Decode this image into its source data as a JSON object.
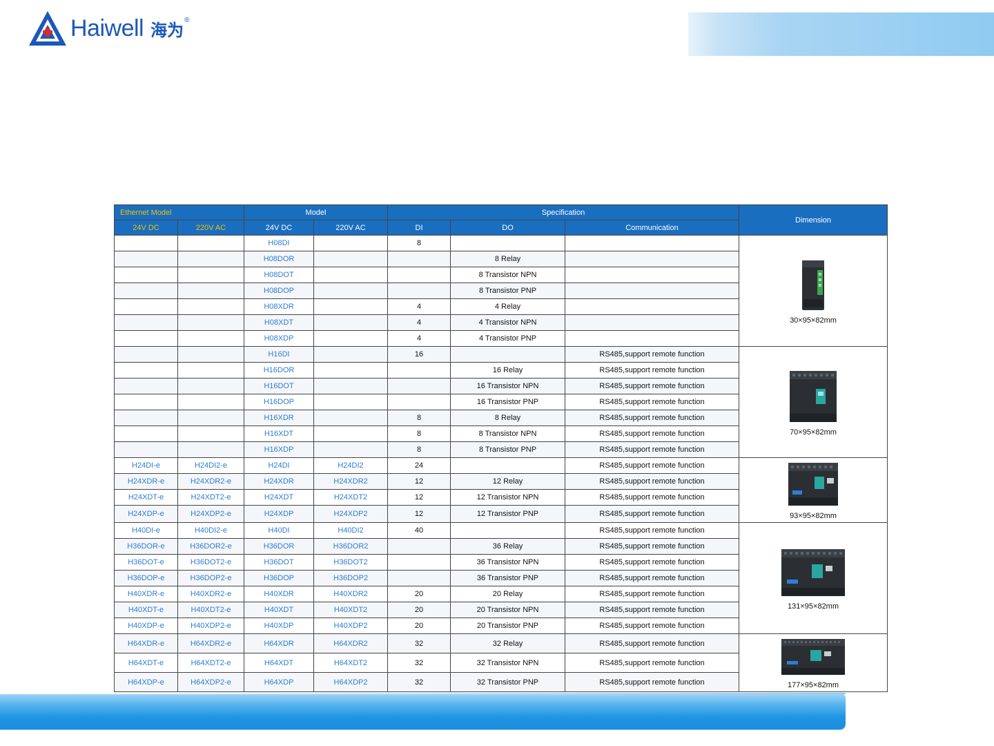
{
  "brand": {
    "name_en": "Haiwell",
    "name_cn": "海为",
    "registered": "®"
  },
  "colors": {
    "header": "#1a6ec0",
    "header_accent": "#f0c000",
    "model_text": "#2d7dd2",
    "brand": "#1b58b8"
  },
  "table": {
    "group_headers": {
      "ethernet": "Ethernet Model",
      "model": "Model",
      "specification": "Specification",
      "dimension": "Dimension"
    },
    "sub_headers": {
      "eth_24vdc": "24V DC",
      "eth_220vac": "220V AC",
      "model_24vdc": "24V DC",
      "model_220vac": "220V AC",
      "di": "DI",
      "do": "DO",
      "communication": "Communication"
    },
    "rows": [
      {
        "eth_dc": "",
        "eth_ac": "",
        "dc": "H08DI",
        "ac": "",
        "di": "8",
        "do": "",
        "comm": ""
      },
      {
        "eth_dc": "",
        "eth_ac": "",
        "dc": "H08DOR",
        "ac": "",
        "di": "",
        "do": "8 Relay",
        "comm": ""
      },
      {
        "eth_dc": "",
        "eth_ac": "",
        "dc": "H08DOT",
        "ac": "",
        "di": "",
        "do": "8 Transistor NPN",
        "comm": ""
      },
      {
        "eth_dc": "",
        "eth_ac": "",
        "dc": "H08DOP",
        "ac": "",
        "di": "",
        "do": "8 Transistor PNP",
        "comm": ""
      },
      {
        "eth_dc": "",
        "eth_ac": "",
        "dc": "H08XDR",
        "ac": "",
        "di": "4",
        "do": "4 Relay",
        "comm": ""
      },
      {
        "eth_dc": "",
        "eth_ac": "",
        "dc": "H08XDT",
        "ac": "",
        "di": "4",
        "do": "4 Transistor NPN",
        "comm": ""
      },
      {
        "eth_dc": "",
        "eth_ac": "",
        "dc": "H08XDP",
        "ac": "",
        "di": "4",
        "do": "4 Transistor PNP",
        "comm": ""
      },
      {
        "eth_dc": "",
        "eth_ac": "",
        "dc": "H16DI",
        "ac": "",
        "di": "16",
        "do": "",
        "comm": "RS485,support remote function"
      },
      {
        "eth_dc": "",
        "eth_ac": "",
        "dc": "H16DOR",
        "ac": "",
        "di": "",
        "do": "16 Relay",
        "comm": "RS485,support remote function"
      },
      {
        "eth_dc": "",
        "eth_ac": "",
        "dc": "H16DOT",
        "ac": "",
        "di": "",
        "do": "16 Transistor NPN",
        "comm": "RS485,support remote function"
      },
      {
        "eth_dc": "",
        "eth_ac": "",
        "dc": "H16DOP",
        "ac": "",
        "di": "",
        "do": "16 Transistor PNP",
        "comm": "RS485,support remote function"
      },
      {
        "eth_dc": "",
        "eth_ac": "",
        "dc": "H16XDR",
        "ac": "",
        "di": "8",
        "do": "8 Relay",
        "comm": "RS485,support remote function"
      },
      {
        "eth_dc": "",
        "eth_ac": "",
        "dc": "H16XDT",
        "ac": "",
        "di": "8",
        "do": "8 Transistor NPN",
        "comm": "RS485,support remote function"
      },
      {
        "eth_dc": "",
        "eth_ac": "",
        "dc": "H16XDP",
        "ac": "",
        "di": "8",
        "do": "8 Transistor PNP",
        "comm": "RS485,support remote function"
      },
      {
        "eth_dc": "H24DI-e",
        "eth_ac": "H24DI2-e",
        "dc": "H24DI",
        "ac": "H24DI2",
        "di": "24",
        "do": "",
        "comm": "RS485,support remote function"
      },
      {
        "eth_dc": "H24XDR-e",
        "eth_ac": "H24XDR2-e",
        "dc": "H24XDR",
        "ac": "H24XDR2",
        "di": "12",
        "do": "12 Relay",
        "comm": "RS485,support remote function"
      },
      {
        "eth_dc": "H24XDT-e",
        "eth_ac": "H24XDT2-e",
        "dc": "H24XDT",
        "ac": "H24XDT2",
        "di": "12",
        "do": "12 Transistor NPN",
        "comm": "RS485,support remote function"
      },
      {
        "eth_dc": "H24XDP-e",
        "eth_ac": "H24XDP2-e",
        "dc": "H24XDP",
        "ac": "H24XDP2",
        "di": "12",
        "do": "12 Transistor PNP",
        "comm": "RS485,support remote function"
      },
      {
        "eth_dc": "H40DI-e",
        "eth_ac": "H40DI2-e",
        "dc": "H40DI",
        "ac": "H40DI2",
        "di": "40",
        "do": "",
        "comm": "RS485,support remote function"
      },
      {
        "eth_dc": "H36DOR-e",
        "eth_ac": "H36DOR2-e",
        "dc": "H36DOR",
        "ac": "H36DOR2",
        "di": "",
        "do": "36 Relay",
        "comm": "RS485,support remote function"
      },
      {
        "eth_dc": "H36DOT-e",
        "eth_ac": "H36DOT2-e",
        "dc": "H36DOT",
        "ac": "H36DOT2",
        "di": "",
        "do": "36 Transistor NPN",
        "comm": "RS485,support remote function"
      },
      {
        "eth_dc": "H36DOP-e",
        "eth_ac": "H36DOP2-e",
        "dc": "H36DOP",
        "ac": "H36DOP2",
        "di": "",
        "do": "36 Transistor PNP",
        "comm": "RS485,support remote function"
      },
      {
        "eth_dc": "H40XDR-e",
        "eth_ac": "H40XDR2-e",
        "dc": "H40XDR",
        "ac": "H40XDR2",
        "di": "20",
        "do": "20 Relay",
        "comm": "RS485,support remote function"
      },
      {
        "eth_dc": "H40XDT-e",
        "eth_ac": "H40XDT2-e",
        "dc": "H40XDT",
        "ac": "H40XDT2",
        "di": "20",
        "do": "20 Transistor NPN",
        "comm": "RS485,support remote function"
      },
      {
        "eth_dc": "H40XDP-e",
        "eth_ac": "H40XDP2-e",
        "dc": "H40XDP",
        "ac": "H40XDP2",
        "di": "20",
        "do": "20 Transistor PNP",
        "comm": "RS485,support remote function"
      },
      {
        "eth_dc": "H64XDR-e",
        "eth_ac": "H64XDR2-e",
        "dc": "H64XDR",
        "ac": "H64XDR2",
        "di": "32",
        "do": "32 Relay",
        "comm": "RS485,support remote function"
      },
      {
        "eth_dc": "H64XDT-e",
        "eth_ac": "H64XDT2-e",
        "dc": "H64XDT",
        "ac": "H64XDT2",
        "di": "32",
        "do": "32 Transistor NPN",
        "comm": "RS485,support remote function"
      },
      {
        "eth_dc": "H64XDP-e",
        "eth_ac": "H64XDP2-e",
        "dc": "H64XDP",
        "ac": "H64XDP2",
        "di": "32",
        "do": "32 Transistor PNP",
        "comm": "RS485,support remote function"
      }
    ],
    "dimension_groups": [
      {
        "label": "30×95×82mm",
        "image": "module-8-point-image"
      },
      {
        "label": "70×95×82mm",
        "image": "module-16-point-image"
      },
      {
        "label": "93×95×82mm",
        "image": "module-24-point-image"
      },
      {
        "label": "131×95×82mm",
        "image": "module-40-point-image"
      },
      {
        "label": "177×95×82mm",
        "image": "module-64-point-image"
      }
    ]
  }
}
